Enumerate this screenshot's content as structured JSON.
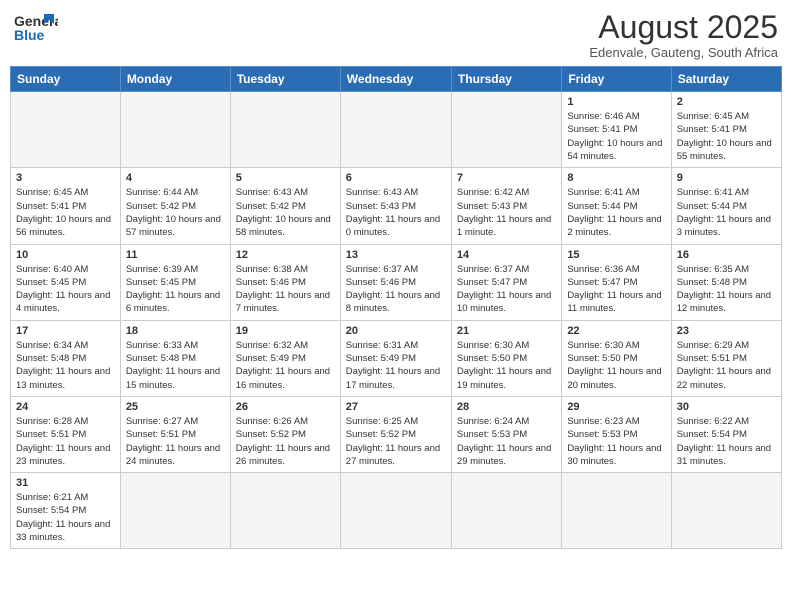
{
  "header": {
    "logo_general": "General",
    "logo_blue": "Blue",
    "month_title": "August 2025",
    "subtitle": "Edenvale, Gauteng, South Africa"
  },
  "weekdays": [
    "Sunday",
    "Monday",
    "Tuesday",
    "Wednesday",
    "Thursday",
    "Friday",
    "Saturday"
  ],
  "weeks": [
    [
      {
        "day": "",
        "info": ""
      },
      {
        "day": "",
        "info": ""
      },
      {
        "day": "",
        "info": ""
      },
      {
        "day": "",
        "info": ""
      },
      {
        "day": "",
        "info": ""
      },
      {
        "day": "1",
        "info": "Sunrise: 6:46 AM\nSunset: 5:41 PM\nDaylight: 10 hours\nand 54 minutes."
      },
      {
        "day": "2",
        "info": "Sunrise: 6:45 AM\nSunset: 5:41 PM\nDaylight: 10 hours\nand 55 minutes."
      }
    ],
    [
      {
        "day": "3",
        "info": "Sunrise: 6:45 AM\nSunset: 5:41 PM\nDaylight: 10 hours\nand 56 minutes."
      },
      {
        "day": "4",
        "info": "Sunrise: 6:44 AM\nSunset: 5:42 PM\nDaylight: 10 hours\nand 57 minutes."
      },
      {
        "day": "5",
        "info": "Sunrise: 6:43 AM\nSunset: 5:42 PM\nDaylight: 10 hours\nand 58 minutes."
      },
      {
        "day": "6",
        "info": "Sunrise: 6:43 AM\nSunset: 5:43 PM\nDaylight: 11 hours\nand 0 minutes."
      },
      {
        "day": "7",
        "info": "Sunrise: 6:42 AM\nSunset: 5:43 PM\nDaylight: 11 hours\nand 1 minute."
      },
      {
        "day": "8",
        "info": "Sunrise: 6:41 AM\nSunset: 5:44 PM\nDaylight: 11 hours\nand 2 minutes."
      },
      {
        "day": "9",
        "info": "Sunrise: 6:41 AM\nSunset: 5:44 PM\nDaylight: 11 hours\nand 3 minutes."
      }
    ],
    [
      {
        "day": "10",
        "info": "Sunrise: 6:40 AM\nSunset: 5:45 PM\nDaylight: 11 hours\nand 4 minutes."
      },
      {
        "day": "11",
        "info": "Sunrise: 6:39 AM\nSunset: 5:45 PM\nDaylight: 11 hours\nand 6 minutes."
      },
      {
        "day": "12",
        "info": "Sunrise: 6:38 AM\nSunset: 5:46 PM\nDaylight: 11 hours\nand 7 minutes."
      },
      {
        "day": "13",
        "info": "Sunrise: 6:37 AM\nSunset: 5:46 PM\nDaylight: 11 hours\nand 8 minutes."
      },
      {
        "day": "14",
        "info": "Sunrise: 6:37 AM\nSunset: 5:47 PM\nDaylight: 11 hours\nand 10 minutes."
      },
      {
        "day": "15",
        "info": "Sunrise: 6:36 AM\nSunset: 5:47 PM\nDaylight: 11 hours\nand 11 minutes."
      },
      {
        "day": "16",
        "info": "Sunrise: 6:35 AM\nSunset: 5:48 PM\nDaylight: 11 hours\nand 12 minutes."
      }
    ],
    [
      {
        "day": "17",
        "info": "Sunrise: 6:34 AM\nSunset: 5:48 PM\nDaylight: 11 hours\nand 13 minutes."
      },
      {
        "day": "18",
        "info": "Sunrise: 6:33 AM\nSunset: 5:48 PM\nDaylight: 11 hours\nand 15 minutes."
      },
      {
        "day": "19",
        "info": "Sunrise: 6:32 AM\nSunset: 5:49 PM\nDaylight: 11 hours\nand 16 minutes."
      },
      {
        "day": "20",
        "info": "Sunrise: 6:31 AM\nSunset: 5:49 PM\nDaylight: 11 hours\nand 17 minutes."
      },
      {
        "day": "21",
        "info": "Sunrise: 6:30 AM\nSunset: 5:50 PM\nDaylight: 11 hours\nand 19 minutes."
      },
      {
        "day": "22",
        "info": "Sunrise: 6:30 AM\nSunset: 5:50 PM\nDaylight: 11 hours\nand 20 minutes."
      },
      {
        "day": "23",
        "info": "Sunrise: 6:29 AM\nSunset: 5:51 PM\nDaylight: 11 hours\nand 22 minutes."
      }
    ],
    [
      {
        "day": "24",
        "info": "Sunrise: 6:28 AM\nSunset: 5:51 PM\nDaylight: 11 hours\nand 23 minutes."
      },
      {
        "day": "25",
        "info": "Sunrise: 6:27 AM\nSunset: 5:51 PM\nDaylight: 11 hours\nand 24 minutes."
      },
      {
        "day": "26",
        "info": "Sunrise: 6:26 AM\nSunset: 5:52 PM\nDaylight: 11 hours\nand 26 minutes."
      },
      {
        "day": "27",
        "info": "Sunrise: 6:25 AM\nSunset: 5:52 PM\nDaylight: 11 hours\nand 27 minutes."
      },
      {
        "day": "28",
        "info": "Sunrise: 6:24 AM\nSunset: 5:53 PM\nDaylight: 11 hours\nand 29 minutes."
      },
      {
        "day": "29",
        "info": "Sunrise: 6:23 AM\nSunset: 5:53 PM\nDaylight: 11 hours\nand 30 minutes."
      },
      {
        "day": "30",
        "info": "Sunrise: 6:22 AM\nSunset: 5:54 PM\nDaylight: 11 hours\nand 31 minutes."
      }
    ],
    [
      {
        "day": "31",
        "info": "Sunrise: 6:21 AM\nSunset: 5:54 PM\nDaylight: 11 hours\nand 33 minutes."
      },
      {
        "day": "",
        "info": ""
      },
      {
        "day": "",
        "info": ""
      },
      {
        "day": "",
        "info": ""
      },
      {
        "day": "",
        "info": ""
      },
      {
        "day": "",
        "info": ""
      },
      {
        "day": "",
        "info": ""
      }
    ]
  ]
}
